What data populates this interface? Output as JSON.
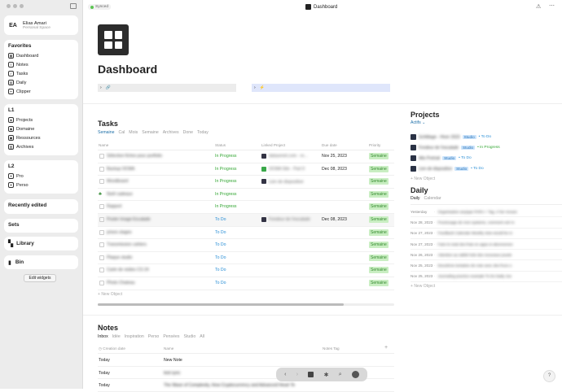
{
  "sidebar": {
    "user": {
      "initials": "EA",
      "name": "Elias Amari",
      "space": "Personal Space"
    },
    "favorites": {
      "title": "Favorites",
      "items": [
        {
          "label": "Dashboard"
        },
        {
          "label": "Notes"
        },
        {
          "label": "Tasks"
        },
        {
          "label": "Daily"
        },
        {
          "label": "Clipper"
        }
      ]
    },
    "l1": {
      "title": "L1",
      "items": [
        {
          "label": "Projects"
        },
        {
          "label": "Domaine"
        },
        {
          "label": "Ressources"
        },
        {
          "label": "Archives"
        }
      ]
    },
    "l2": {
      "title": "L2",
      "items": [
        {
          "label": "Pro"
        },
        {
          "label": "Perso"
        }
      ]
    },
    "recent_label": "Recently edited",
    "sets_label": "Sets",
    "library_label": "Library",
    "bin_label": "Bin",
    "edit_widgets": "Edit widgets"
  },
  "topbar": {
    "sync": "Synced",
    "title": "Dashboard"
  },
  "page": {
    "title": "Dashboard"
  },
  "tasks": {
    "title": "Tasks",
    "tabs": [
      "Semaine",
      "Cal",
      "Mois",
      "Semaine",
      "Archives",
      "Done",
      "Today"
    ],
    "columns": [
      "Name",
      "Status",
      "Linked Project",
      "Due date",
      "Priority"
    ],
    "rows": [
      {
        "name": "Sélection fiches pour portfolio",
        "status": "In Progress",
        "project": "datasenet.com - re...",
        "due": "Nov 25, 2023",
        "priority": "Semaine"
      },
      {
        "name": "Backup OCMA",
        "status": "In Progress",
        "project": "OCMA Site - Part II",
        "due": "Dec 08, 2023",
        "priority": "Semaine"
      },
      {
        "name": "Moodboard",
        "status": "In Progress",
        "project": "Lien de dispositive",
        "due": "",
        "priority": "Semaine"
      },
      {
        "name": "Noël cadeaux",
        "status": "In Progress",
        "project": "",
        "due": "",
        "priority": "Semaine"
      },
      {
        "name": "Rapport",
        "status": "In Progress",
        "project": "",
        "due": "",
        "priority": "Semaine"
      },
      {
        "name": "Poster Image Escalade",
        "status": "To Do",
        "project": "Fondeur de l'escalade",
        "due": "Dec 08, 2023",
        "priority": "Semaine"
      },
      {
        "name": "prises stages",
        "status": "To Do",
        "project": "",
        "due": "",
        "priority": "Semaine"
      },
      {
        "name": "Transmission cahiers",
        "status": "To Do",
        "project": "",
        "due": "",
        "priority": "Semaine"
      },
      {
        "name": "Plaque studio",
        "status": "To Do",
        "project": "",
        "due": "",
        "priority": "Semaine"
      },
      {
        "name": "Carte de visites CS 24",
        "status": "To Do",
        "project": "",
        "due": "",
        "priority": "Semaine"
      },
      {
        "name": "Photo Chateau",
        "status": "To Do",
        "project": "",
        "due": "",
        "priority": "Semaine"
      }
    ],
    "new_object": "New Object"
  },
  "projects": {
    "title": "Projects",
    "filter": "Actifs",
    "items": [
      {
        "name": "Schlittage - Hiver 2023",
        "tag": "Studio",
        "status": "To Do"
      },
      {
        "name": "Fondeur de l'escalade",
        "tag": "Studio",
        "status": "In Progress"
      },
      {
        "name": "Alto Portrait",
        "tag": "Studio",
        "status": "To Do"
      },
      {
        "name": "Lien de dispositive",
        "tag": "Studio",
        "status": "To Do"
      }
    ],
    "new_object": "New Object"
  },
  "daily": {
    "title": "Daily",
    "tabs": [
      "Daily",
      "Calendar"
    ],
    "items": [
      {
        "date": "Yesterday",
        "text": "Organisation anyIype PARA + Tag, ri her revues"
      },
      {
        "date": "Nov 28, 2023",
        "text": "Pourtouage de mon systeme, comment voir m"
      },
      {
        "date": "Nov 27, 2023",
        "text": "Feedback Calendar Weekly view would be m"
      },
      {
        "date": "Nov 27, 2023",
        "text": "Faire le total des frais en apps et abonnemen"
      },
      {
        "date": "Nov 26, 2023",
        "text": "Attention au rabbit hole des nouveaux jouets"
      },
      {
        "date": "Nov 25, 2023",
        "text": "Deuxième tentative de note avec des frucs o"
      },
      {
        "date": "Nov 25, 2023",
        "text": "Journaling practice example To Do Daily Jou"
      }
    ],
    "new_object": "New Object"
  },
  "notes": {
    "title": "Notes",
    "tabs": [
      "Inbox",
      "Idée",
      "Inspiration",
      "Perso",
      "Pensées",
      "Studio",
      "All"
    ],
    "columns": [
      "Creation date",
      "Name",
      "Notes Tag"
    ],
    "rows": [
      {
        "date": "Today",
        "name": "New Note"
      },
      {
        "date": "Today",
        "name": "test sync"
      },
      {
        "date": "Today",
        "name": "The Wave of Complexity, How Cryptocurrency and Advanced Heart Te"
      }
    ]
  },
  "colors": {
    "accent": "#1d6fa8",
    "in_progress": "#33a633",
    "todo": "#2b8fd6",
    "priority_bg": "#c9eec2"
  }
}
